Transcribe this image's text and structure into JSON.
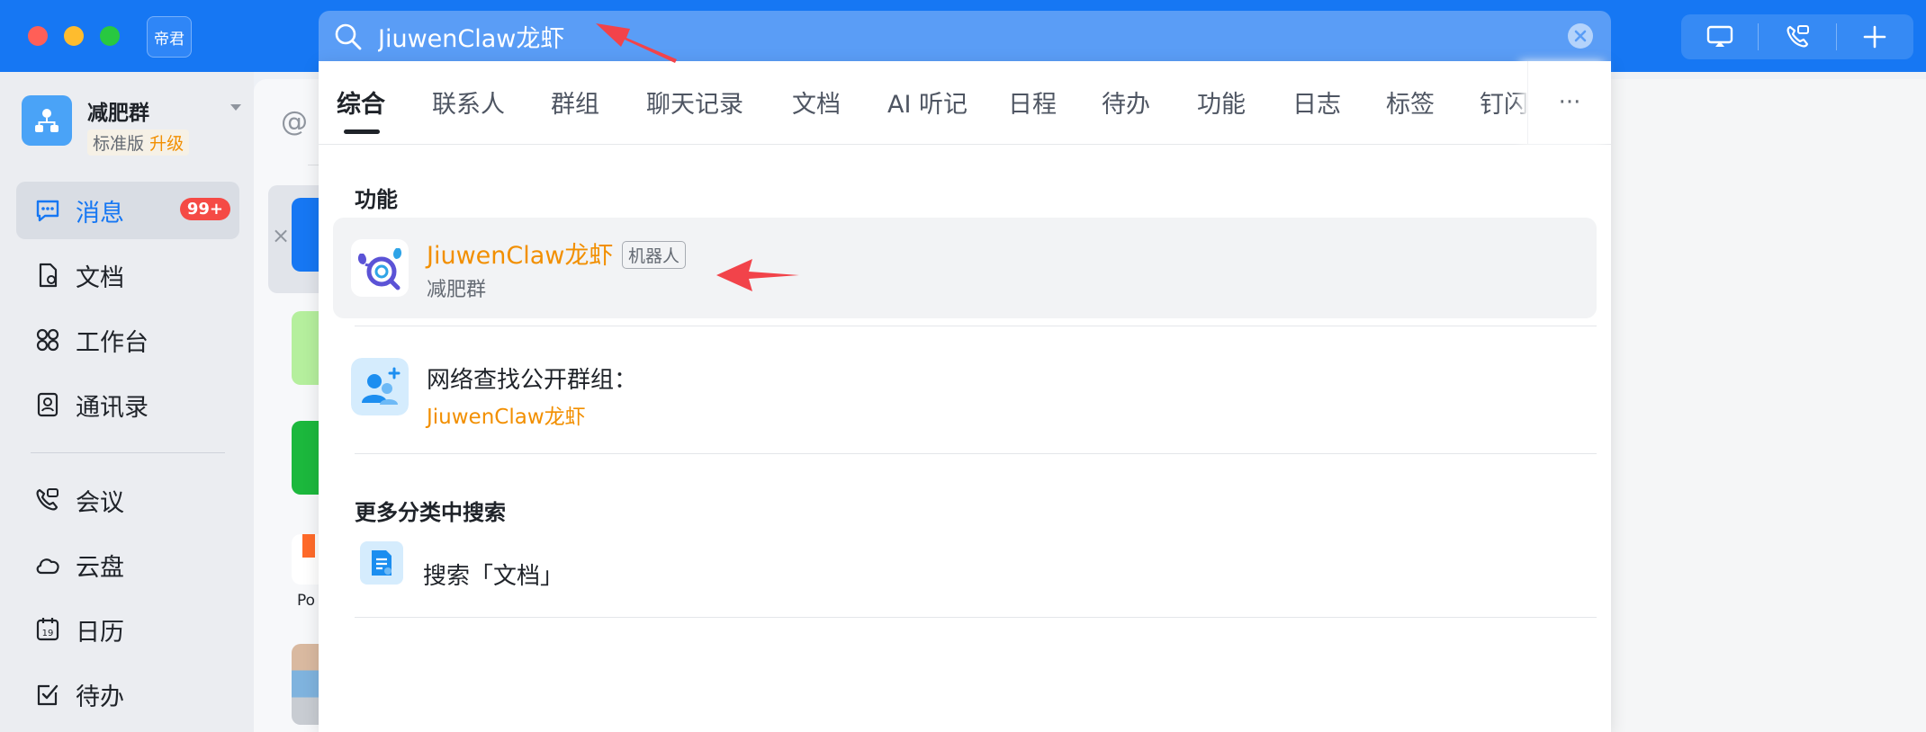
{
  "app": {
    "logo_text": "帝君",
    "brand_color": "#1677f3"
  },
  "workspace": {
    "name": "减肥群",
    "edition": "标准版",
    "upgrade": "升级"
  },
  "sidebar": {
    "items": [
      {
        "label": "消息",
        "icon": "message-icon",
        "badge": "99+",
        "active": true
      },
      {
        "label": "文档",
        "icon": "document-icon"
      },
      {
        "label": "工作台",
        "icon": "workbench-icon"
      },
      {
        "label": "通讯录",
        "icon": "contacts-icon"
      },
      {
        "label": "会议",
        "icon": "meeting-icon"
      },
      {
        "label": "云盘",
        "icon": "cloud-drive-icon"
      },
      {
        "label": "日历",
        "icon": "calendar-icon"
      },
      {
        "label": "待办",
        "icon": "todo-icon"
      }
    ]
  },
  "chat_list": {
    "partial_label": "Po"
  },
  "search": {
    "value": "JiuwenClaw龙虾"
  },
  "tabs": [
    "综合",
    "联系人",
    "群组",
    "聊天记录",
    "文档",
    "AI 听记",
    "日程",
    "待办",
    "功能",
    "日志",
    "标签",
    "钉闪"
  ],
  "tabs_more": "···",
  "results": {
    "section_function": "功能",
    "bot": {
      "title": "JiuwenClaw龙虾",
      "tag": "机器人",
      "subtitle": "减肥群"
    },
    "network_group": {
      "title": "网络查找公开群组：",
      "subtitle": "JiuwenClaw龙虾"
    },
    "section_more": "更多分类中搜索",
    "search_docs": "搜索「文档」"
  },
  "colors": {
    "highlight": "#f28f00",
    "badge": "#f54a45",
    "annotation": "#f2434a"
  }
}
